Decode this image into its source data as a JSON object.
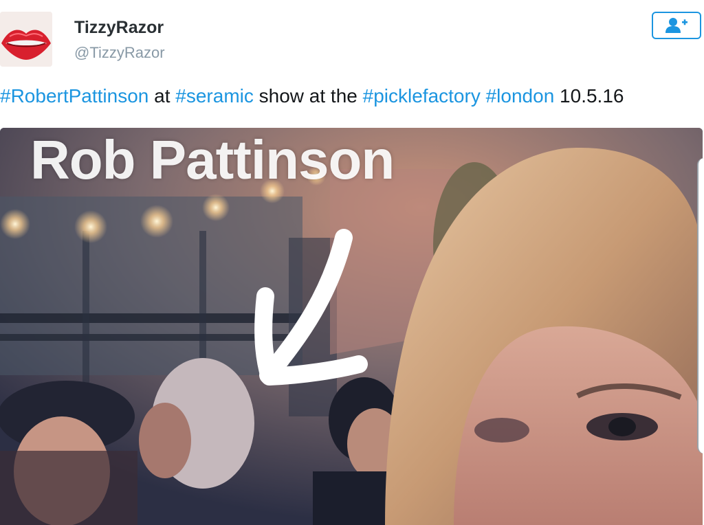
{
  "user": {
    "display_name": "TizzyRazor",
    "handle": "@TizzyRazor",
    "avatar_icon": "red-lips-avatar"
  },
  "follow_button": {
    "icon": "follow-person-plus-icon",
    "color": "#1b95e0"
  },
  "tweet": {
    "segments": [
      {
        "text": "#RobertPattinson",
        "type": "hashtag"
      },
      {
        "text": " at ",
        "type": "text"
      },
      {
        "text": "#seramic",
        "type": "hashtag"
      },
      {
        "text": " show at the ",
        "type": "text"
      },
      {
        "text": "#picklefactory",
        "type": "hashtag"
      },
      {
        "text": " ",
        "type": "text"
      },
      {
        "text": "#london",
        "type": "hashtag"
      },
      {
        "text": " 10.5.16",
        "type": "text"
      }
    ]
  },
  "photo": {
    "caption": "Rob Pattinson"
  },
  "colors": {
    "link": "#1b95e0",
    "name": "#292f33",
    "handle": "#8899a6",
    "text": "#14171a"
  }
}
